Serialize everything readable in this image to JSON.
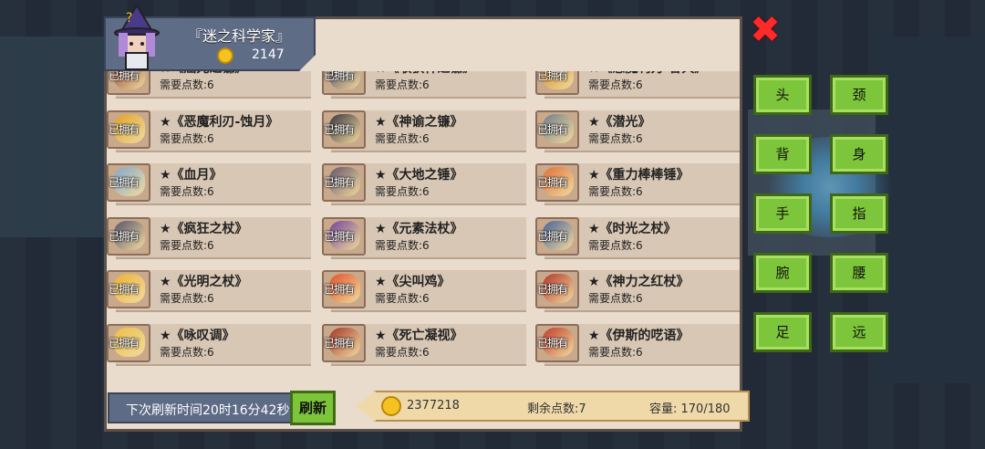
{
  "player": {
    "name": "『迷之科学家』",
    "gold": "2147"
  },
  "owned_label": "已拥有",
  "items": [
    {
      "name": "★《屈光之镰》",
      "cost": "需要点数:6",
      "color": "#8e3a2a"
    },
    {
      "name": "★《收获神之镰》",
      "cost": "需要点数:6",
      "color": "#3a3a5a"
    },
    {
      "name": "★《恶魔利刃-吞天》",
      "cost": "需要点数:6",
      "color": "#d88a20"
    },
    {
      "name": "★《恶魔利刃-蚀月》",
      "cost": "需要点数:6",
      "color": "#e0a020"
    },
    {
      "name": "★《神谕之镰》",
      "cost": "需要点数:6",
      "color": "#2a2a3a"
    },
    {
      "name": "★《潜光》",
      "cost": "需要点数:6",
      "color": "#6a7a8a"
    },
    {
      "name": "★《血月》",
      "cost": "需要点数:6",
      "color": "#7aa8d8"
    },
    {
      "name": "★《大地之锤》",
      "cost": "需要点数:6",
      "color": "#5a4a6a"
    },
    {
      "name": "★《重力棒棒锤》",
      "cost": "需要点数:6",
      "color": "#e06a30"
    },
    {
      "name": "★《疯狂之杖》",
      "cost": "需要点数:6",
      "color": "#4a4a6a"
    },
    {
      "name": "★《元素法杖》",
      "cost": "需要点数:6",
      "color": "#6a3a9a"
    },
    {
      "name": "★《时光之杖》",
      "cost": "需要点数:6",
      "color": "#3a5a9a"
    },
    {
      "name": "★《光明之杖》",
      "cost": "需要点数:6",
      "color": "#f0b030"
    },
    {
      "name": "★《尖叫鸡》",
      "cost": "需要点数:6",
      "color": "#e04a20"
    },
    {
      "name": "★《神力之红杖》",
      "cost": "需要点数:6",
      "color": "#b02a20"
    },
    {
      "name": "★《咏叹调》",
      "cost": "需要点数:6",
      "color": "#f0c040"
    },
    {
      "name": "★《死亡凝视》",
      "cost": "需要点数:6",
      "color": "#a02a20"
    },
    {
      "name": "★《伊斯的呓语》",
      "cost": "需要点数:6",
      "color": "#c03020"
    }
  ],
  "bottom": {
    "refresh_text": "下次刷新时间20时16分42秒",
    "refresh_button": "刷新",
    "money": "2377218",
    "points": "剩余点数:7",
    "capacity": "容量:  170/180"
  },
  "close": "✖",
  "slots": [
    "头",
    "颈",
    "背",
    "身",
    "手",
    "指",
    "腕",
    "腰",
    "足",
    "远"
  ]
}
